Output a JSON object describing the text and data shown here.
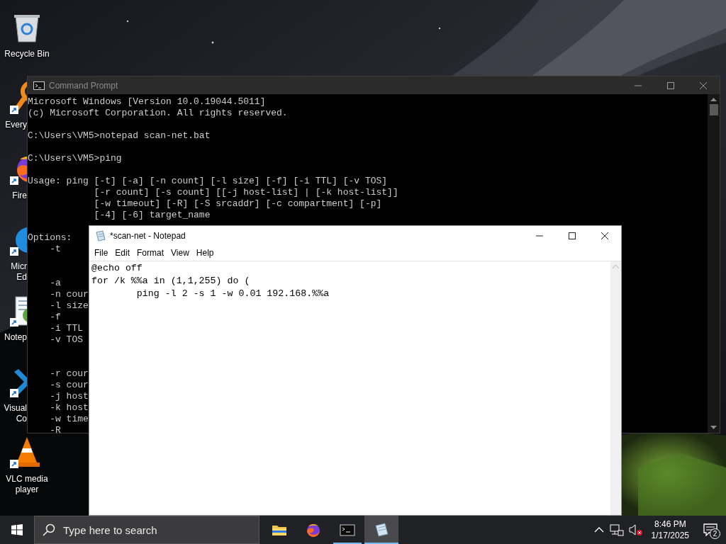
{
  "desktop": {
    "icons": [
      {
        "kind": "bin",
        "label": "Recycle Bin",
        "shortcut": false,
        "partly_hidden": false
      },
      {
        "kind": "magnifier",
        "label": "Every",
        "shortcut": true,
        "partly_hidden": true
      },
      {
        "kind": "fox",
        "label": "Fire",
        "shortcut": true,
        "partly_hidden": true
      },
      {
        "kind": "wave",
        "label": "Micr Ed",
        "shortcut": true,
        "partly_hidden": true
      },
      {
        "kind": "notepad",
        "label": "Notep",
        "shortcut": true,
        "partly_hidden": true
      },
      {
        "kind": "code",
        "label": "Visual Co",
        "shortcut": true,
        "partly_hidden": true
      },
      {
        "kind": "cone",
        "label": "VLC media player",
        "shortcut": true,
        "partly_hidden": false
      }
    ]
  },
  "command_prompt": {
    "title": "Command Prompt",
    "focused": false,
    "lines": [
      {
        "kind": "text",
        "text": "Microsoft Windows [Version 10.0.19044.5011]"
      },
      {
        "kind": "text",
        "text": "(c) Microsoft Corporation. All rights reserved."
      },
      {
        "kind": "blank"
      },
      {
        "kind": "text",
        "text": "C:\\Users\\VM5>notepad scan-net.bat"
      },
      {
        "kind": "blank"
      },
      {
        "kind": "text",
        "text": "C:\\Users\\VM5>ping"
      },
      {
        "kind": "blank"
      },
      {
        "kind": "text",
        "text": "Usage: ping [-t] [-a] [-n count] [-l size] [-f] [-i TTL] [-v TOS]"
      },
      {
        "kind": "text",
        "text": "            [-r count] [-s count] [[-j host-list] | [-k host-list]]"
      },
      {
        "kind": "text",
        "text": "            [-w timeout] [-R] [-S srcaddr] [-c compartment] [-p]"
      },
      {
        "kind": "text",
        "text": "            [-4] [-6] target_name"
      },
      {
        "kind": "blank"
      },
      {
        "kind": "text",
        "text": "Options:"
      },
      {
        "kind": "text",
        "text": "    -t"
      },
      {
        "kind": "blank"
      },
      {
        "kind": "blank"
      },
      {
        "kind": "text",
        "text": "    -a"
      },
      {
        "kind": "text",
        "text": "    -n cour"
      },
      {
        "kind": "text",
        "text": "    -l size"
      },
      {
        "kind": "text",
        "text": "    -f"
      },
      {
        "kind": "text",
        "text": "    -i TTL"
      },
      {
        "kind": "text",
        "text": "    -v TOS"
      },
      {
        "kind": "blank"
      },
      {
        "kind": "blank"
      },
      {
        "kind": "text",
        "text": "    -r cour"
      },
      {
        "kind": "text",
        "text": "    -s cour"
      },
      {
        "kind": "text",
        "text": "    -j host"
      },
      {
        "kind": "text",
        "text": "    -k host"
      },
      {
        "kind": "text",
        "text": "    -w time"
      },
      {
        "kind": "text",
        "text": "    -R"
      }
    ]
  },
  "notepad": {
    "title": "*scan-net - Notepad",
    "focused": true,
    "menu": [
      "File",
      "Edit",
      "Format",
      "View",
      "Help"
    ],
    "lines": [
      "@echo off",
      "for /k %%a in (1,1,255) do (",
      "\tping -l 2 -s 1 -w 0.01 192.168.%%a"
    ]
  },
  "taskbar": {
    "search": {
      "placeholder": "Type here to search"
    },
    "apps": [
      {
        "kind": "folder",
        "running": false,
        "active": false
      },
      {
        "kind": "fox",
        "running": false,
        "active": false
      },
      {
        "kind": "console",
        "running": true,
        "active": false
      },
      {
        "kind": "notepad",
        "running": true,
        "active": true
      }
    ],
    "tray": {
      "volume_muted": true,
      "time": "8:46 PM",
      "date": "1/17/2025",
      "notifications": "2"
    }
  }
}
